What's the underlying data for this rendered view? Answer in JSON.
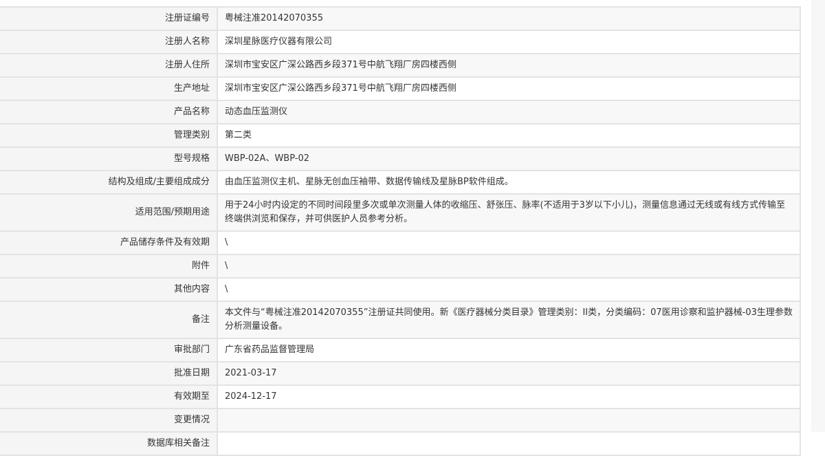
{
  "rows": [
    {
      "label": "注册证编号",
      "value": "粤械注准20142070355"
    },
    {
      "label": "注册人名称",
      "value": "深圳星脉医疗仪器有限公司"
    },
    {
      "label": "注册人住所",
      "value": "深圳市宝安区广深公路西乡段371号中航飞翔厂房四楼西侧"
    },
    {
      "label": "生产地址",
      "value": "深圳市宝安区广深公路西乡段371号中航飞翔厂房四楼西侧"
    },
    {
      "label": "产品名称",
      "value": "动态血压监测仪"
    },
    {
      "label": "管理类别",
      "value": "第二类"
    },
    {
      "label": "型号规格",
      "value": "WBP-02A、WBP-02"
    },
    {
      "label": "结构及组成/主要组成成分",
      "value": "由血压监测仪主机、星脉无创血压袖带、数据传输线及星脉BP软件组成。"
    },
    {
      "label": "适用范围/预期用途",
      "value": "用于24小时内设定的不同时间段里多次或单次测量人体的收缩压、舒张压、脉率(不适用于3岁以下小儿)，测量信息通过无线或有线方式传输至终端供浏览和保存，并可供医护人员参考分析。"
    },
    {
      "label": "产品储存条件及有效期",
      "value": "\\"
    },
    {
      "label": "附件",
      "value": "\\"
    },
    {
      "label": "其他内容",
      "value": "\\"
    },
    {
      "label": "备注",
      "value": "本文件与“粤械注准20142070355”注册证共同使用。新《医疗器械分类目录》管理类别：II类，分类编码：07医用诊察和监护器械-03生理参数分析测量设备。"
    },
    {
      "label": "审批部门",
      "value": "广东省药品监督管理局"
    },
    {
      "label": "批准日期",
      "value": "2021-03-17"
    },
    {
      "label": "有效期至",
      "value": "2024-12-17"
    },
    {
      "label": "变更情况",
      "value": ""
    },
    {
      "label": "数据库相关备注",
      "value": ""
    }
  ]
}
